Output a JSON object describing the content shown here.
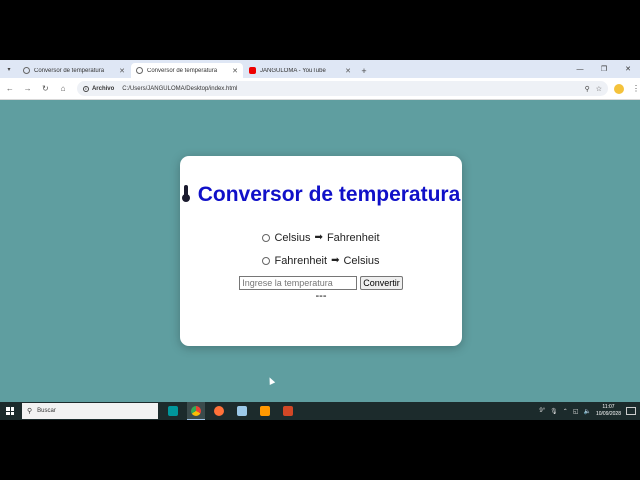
{
  "browser": {
    "tabs": [
      {
        "title": "Conversor de temperatura",
        "active": false,
        "icon": "globe-icon"
      },
      {
        "title": "Conversor de temperatura",
        "active": true,
        "icon": "globe-icon"
      },
      {
        "title": "JANGULOMA - YouTube",
        "active": false,
        "icon": "youtube-icon"
      }
    ],
    "address": {
      "site_chip": "Archivo",
      "url": "C:/Users/JANGULOMA/Desktop/index.html"
    }
  },
  "page": {
    "icon": "thermometer-icon",
    "title": "Conversor de temperatura",
    "options": [
      {
        "from": "Celsius",
        "to": "Fahrenheit",
        "checked": false
      },
      {
        "from": "Fahrenheit",
        "to": "Celsius",
        "checked": false
      }
    ],
    "input": {
      "value": "",
      "placeholder": "Ingrese la temperatura"
    },
    "button_label": "Convertir",
    "result": "---"
  },
  "taskbar": {
    "search_placeholder": "Buscar",
    "tray": {
      "weather": "9°",
      "time": "11:07",
      "date": "10/09/2028"
    }
  },
  "colors": {
    "page_background": "#5f9ea0",
    "title_color": "#1010c8",
    "card_background": "#ffffff"
  }
}
